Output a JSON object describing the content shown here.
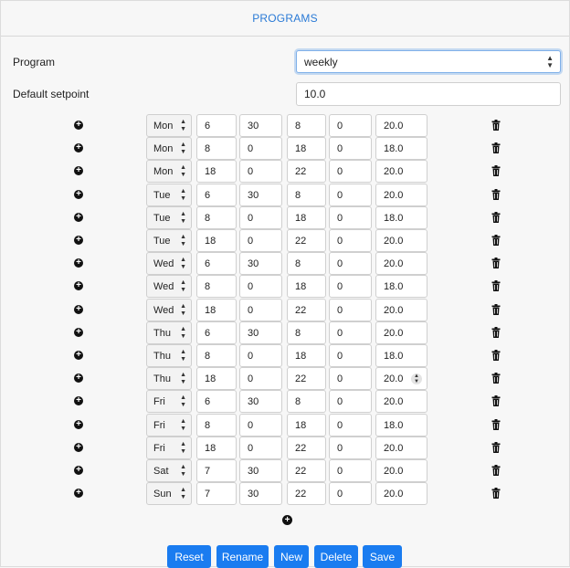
{
  "header": {
    "title": "PROGRAMS"
  },
  "program": {
    "label": "Program",
    "value": "weekly"
  },
  "default_setpoint": {
    "label": "Default setpoint",
    "value": "10.0"
  },
  "rows": [
    {
      "day": "Mon",
      "start_h": "6",
      "start_m": "30",
      "end_h": "8",
      "end_m": "0",
      "setpoint": "20.0"
    },
    {
      "day": "Mon",
      "start_h": "8",
      "start_m": "0",
      "end_h": "18",
      "end_m": "0",
      "setpoint": "18.0"
    },
    {
      "day": "Mon",
      "start_h": "18",
      "start_m": "0",
      "end_h": "22",
      "end_m": "0",
      "setpoint": "20.0"
    },
    {
      "day": "Tue",
      "start_h": "6",
      "start_m": "30",
      "end_h": "8",
      "end_m": "0",
      "setpoint": "20.0"
    },
    {
      "day": "Tue",
      "start_h": "8",
      "start_m": "0",
      "end_h": "18",
      "end_m": "0",
      "setpoint": "18.0"
    },
    {
      "day": "Tue",
      "start_h": "18",
      "start_m": "0",
      "end_h": "22",
      "end_m": "0",
      "setpoint": "20.0"
    },
    {
      "day": "Wed",
      "start_h": "6",
      "start_m": "30",
      "end_h": "8",
      "end_m": "0",
      "setpoint": "20.0"
    },
    {
      "day": "Wed",
      "start_h": "8",
      "start_m": "0",
      "end_h": "18",
      "end_m": "0",
      "setpoint": "18.0"
    },
    {
      "day": "Wed",
      "start_h": "18",
      "start_m": "0",
      "end_h": "22",
      "end_m": "0",
      "setpoint": "20.0"
    },
    {
      "day": "Thu",
      "start_h": "6",
      "start_m": "30",
      "end_h": "8",
      "end_m": "0",
      "setpoint": "20.0"
    },
    {
      "day": "Thu",
      "start_h": "8",
      "start_m": "0",
      "end_h": "18",
      "end_m": "0",
      "setpoint": "18.0"
    },
    {
      "day": "Thu",
      "start_h": "18",
      "start_m": "0",
      "end_h": "22",
      "end_m": "0",
      "setpoint": "20.0"
    },
    {
      "day": "Fri",
      "start_h": "6",
      "start_m": "30",
      "end_h": "8",
      "end_m": "0",
      "setpoint": "20.0"
    },
    {
      "day": "Fri",
      "start_h": "8",
      "start_m": "0",
      "end_h": "18",
      "end_m": "0",
      "setpoint": "18.0"
    },
    {
      "day": "Fri",
      "start_h": "18",
      "start_m": "0",
      "end_h": "22",
      "end_m": "0",
      "setpoint": "20.0"
    },
    {
      "day": "Sat",
      "start_h": "7",
      "start_m": "30",
      "end_h": "22",
      "end_m": "0",
      "setpoint": "20.0"
    },
    {
      "day": "Sun",
      "start_h": "7",
      "start_m": "30",
      "end_h": "22",
      "end_m": "0",
      "setpoint": "20.0"
    }
  ],
  "buttons": {
    "reset": "Reset",
    "rename": "Rename",
    "new": "New",
    "delete": "Delete",
    "save": "Save"
  },
  "colors": {
    "accent": "#1a7cf0",
    "header_text": "#2a7ad6"
  },
  "icons": {
    "add": "plus-circle-icon",
    "remove": "trash-icon"
  }
}
